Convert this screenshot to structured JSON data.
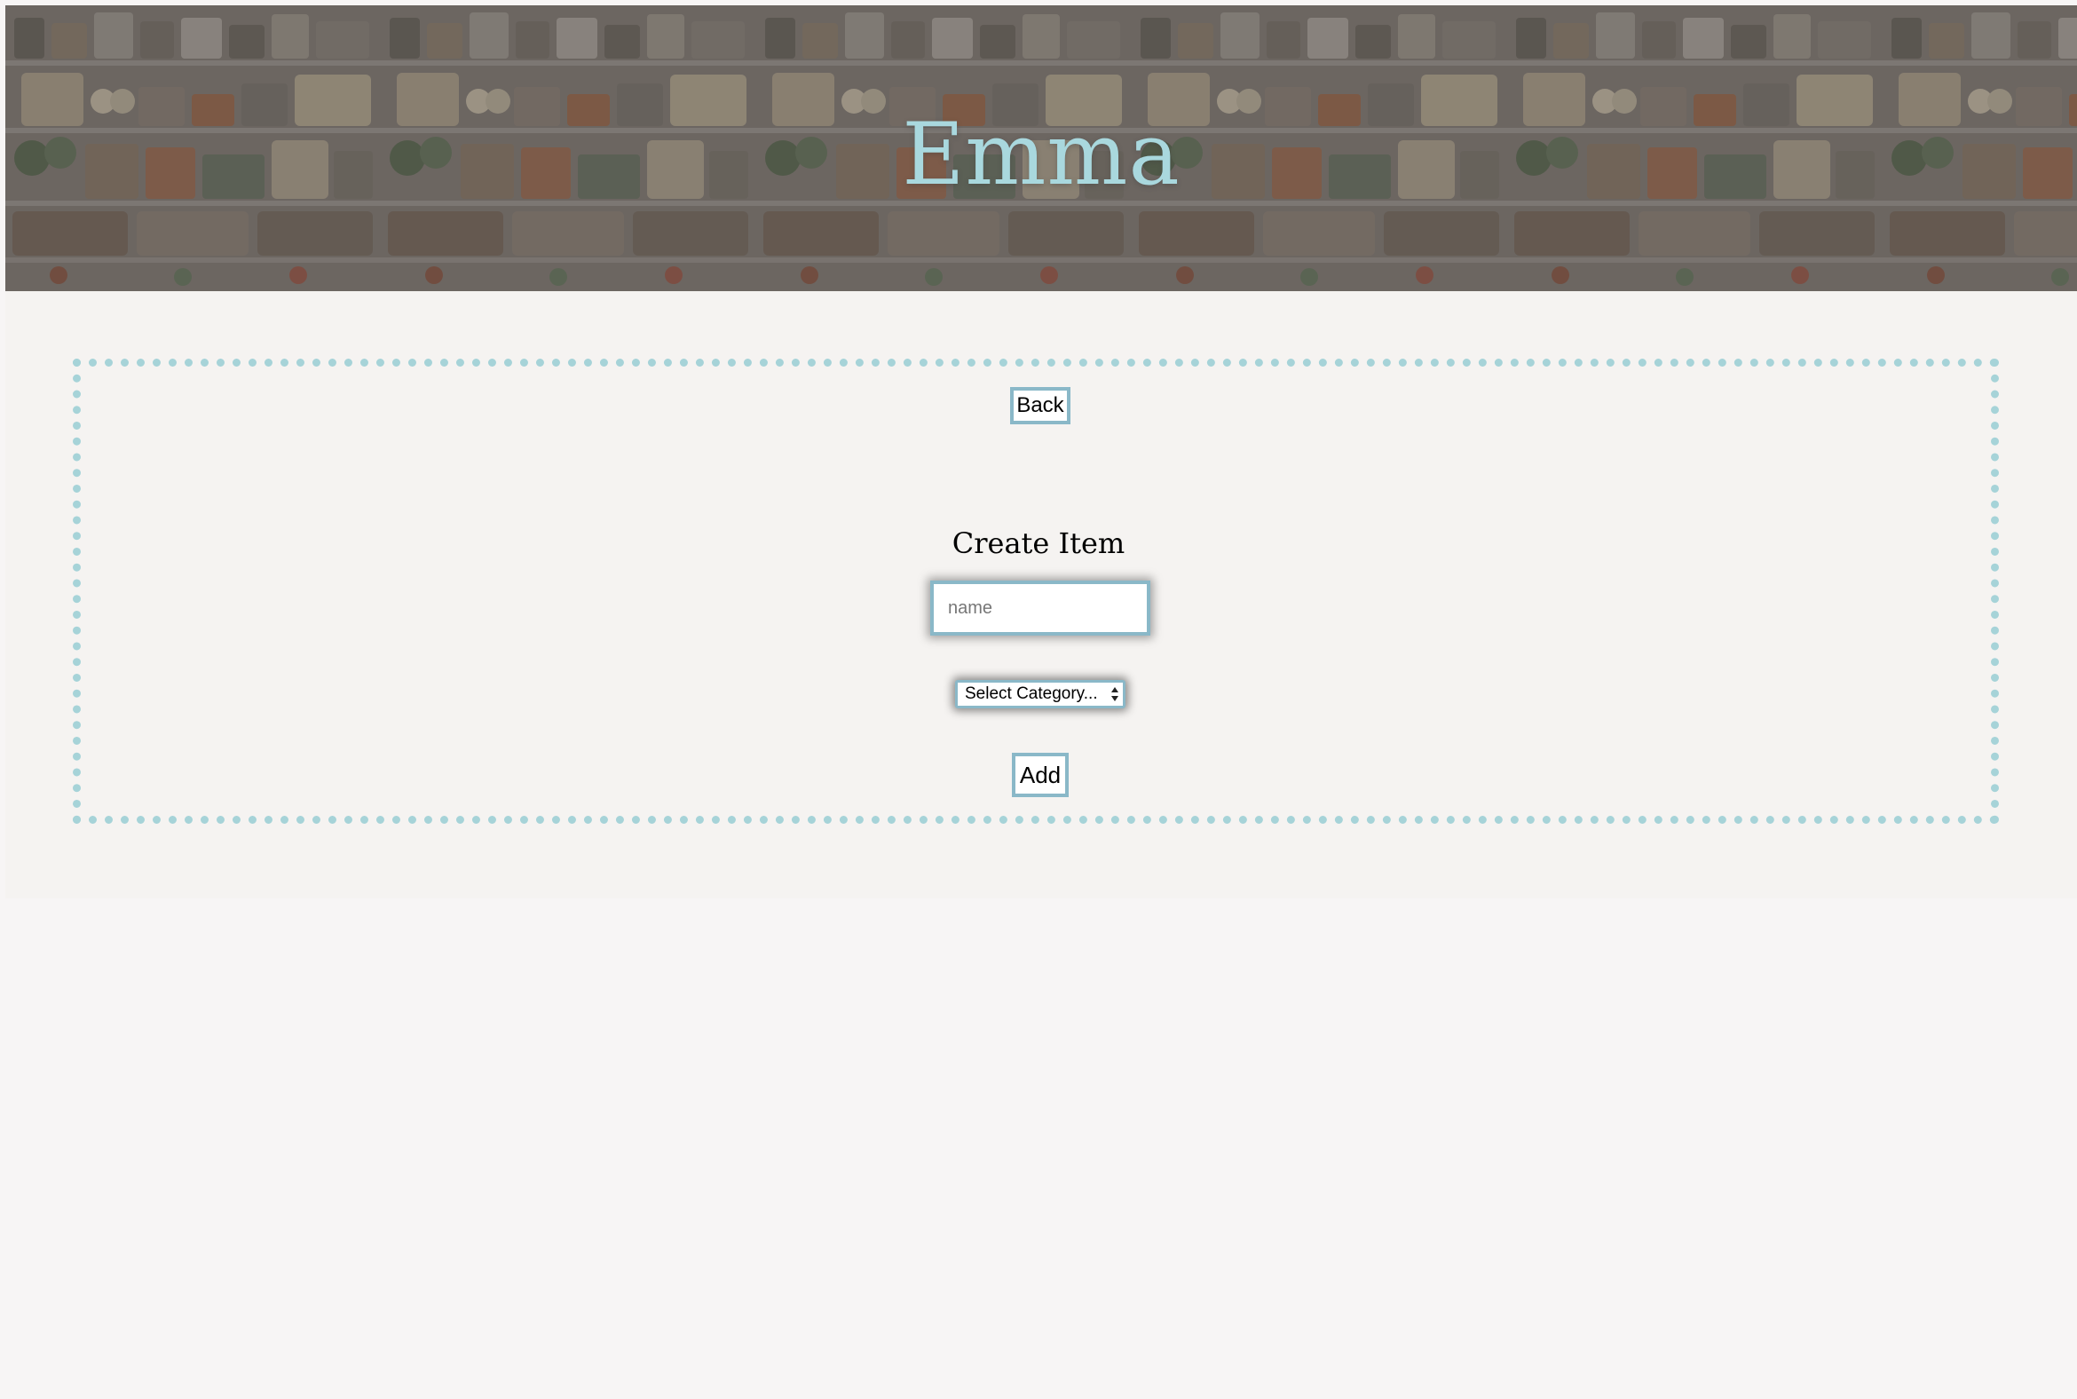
{
  "header": {
    "title": "Emma"
  },
  "form": {
    "back_label": "Back",
    "heading": "Create Item",
    "name_placeholder": "name",
    "category_selected": "Select Category...",
    "add_label": "Add"
  },
  "colors": {
    "accent": "#a6d3d8",
    "title": "#a9d8de",
    "button_border": "#8ab8c8",
    "page_background": "#f5f3f1"
  },
  "icons": {
    "select_arrows": "chevron-up-down-icon"
  }
}
